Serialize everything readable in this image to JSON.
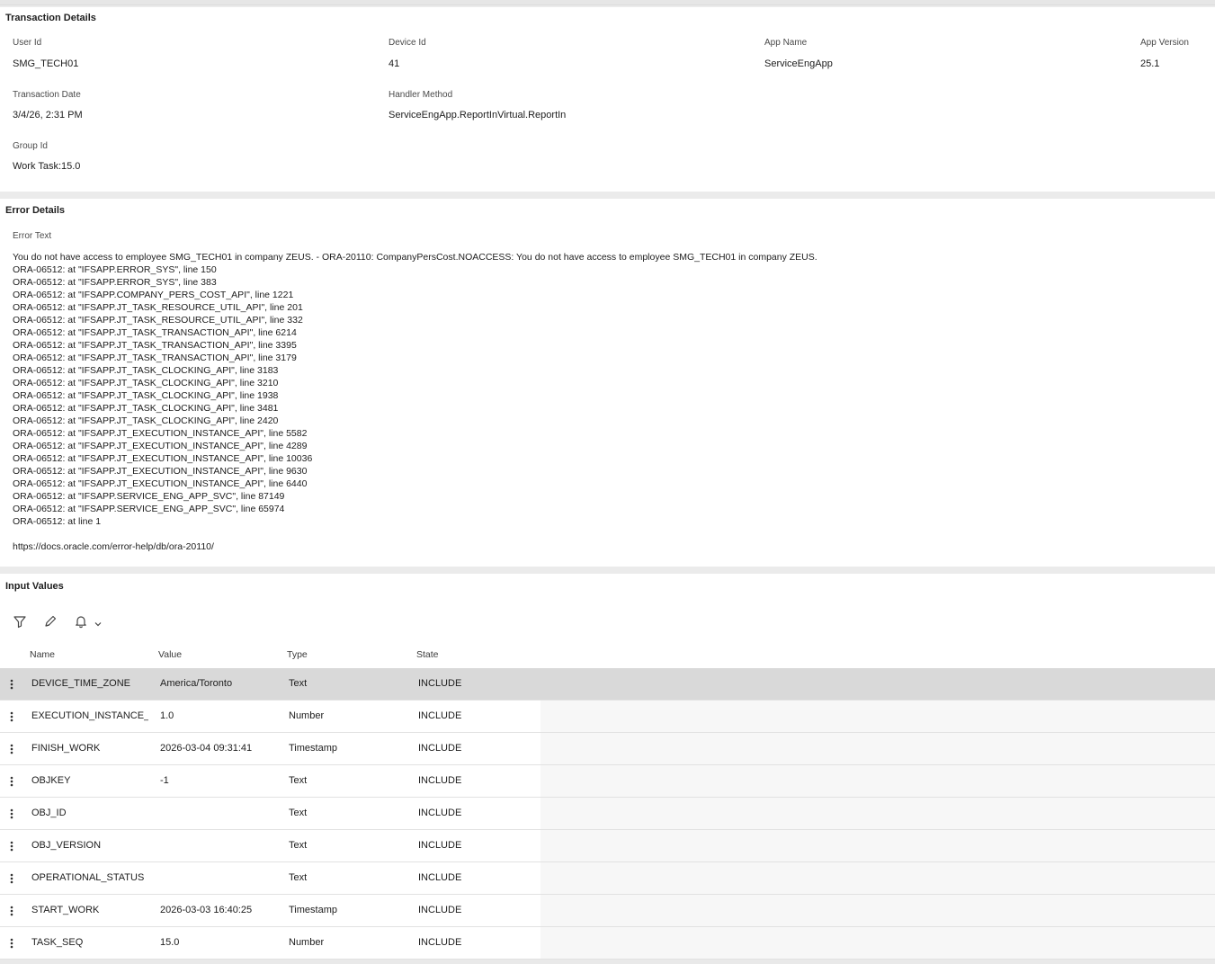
{
  "transaction": {
    "title": "Transaction Details",
    "user_id_label": "User Id",
    "user_id": "SMG_TECH01",
    "device_id_label": "Device Id",
    "device_id": "41",
    "app_name_label": "App Name",
    "app_name": "ServiceEngApp",
    "app_version_label": "App Version",
    "app_version": "25.1",
    "transaction_date_label": "Transaction Date",
    "transaction_date": "3/4/26, 2:31 PM",
    "handler_method_label": "Handler Method",
    "handler_method": "ServiceEngApp.ReportInVirtual.ReportIn",
    "group_id_label": "Group Id",
    "group_id": "Work Task:15.0"
  },
  "error": {
    "title": "Error Details",
    "text_label": "Error Text",
    "text": "You do not have access to employee SMG_TECH01 in company ZEUS. - ORA-20110: CompanyPersCost.NOACCESS: You do not have access to employee SMG_TECH01 in company ZEUS.\nORA-06512: at \"IFSAPP.ERROR_SYS\", line 150\nORA-06512: at \"IFSAPP.ERROR_SYS\", line 383\nORA-06512: at \"IFSAPP.COMPANY_PERS_COST_API\", line 1221\nORA-06512: at \"IFSAPP.JT_TASK_RESOURCE_UTIL_API\", line 201\nORA-06512: at \"IFSAPP.JT_TASK_RESOURCE_UTIL_API\", line 332\nORA-06512: at \"IFSAPP.JT_TASK_TRANSACTION_API\", line 6214\nORA-06512: at \"IFSAPP.JT_TASK_TRANSACTION_API\", line 3395\nORA-06512: at \"IFSAPP.JT_TASK_TRANSACTION_API\", line 3179\nORA-06512: at \"IFSAPP.JT_TASK_CLOCKING_API\", line 3183\nORA-06512: at \"IFSAPP.JT_TASK_CLOCKING_API\", line 3210\nORA-06512: at \"IFSAPP.JT_TASK_CLOCKING_API\", line 1938\nORA-06512: at \"IFSAPP.JT_TASK_CLOCKING_API\", line 3481\nORA-06512: at \"IFSAPP.JT_TASK_CLOCKING_API\", line 2420\nORA-06512: at \"IFSAPP.JT_EXECUTION_INSTANCE_API\", line 5582\nORA-06512: at \"IFSAPP.JT_EXECUTION_INSTANCE_API\", line 4289\nORA-06512: at \"IFSAPP.JT_EXECUTION_INSTANCE_API\", line 10036\nORA-06512: at \"IFSAPP.JT_EXECUTION_INSTANCE_API\", line 9630\nORA-06512: at \"IFSAPP.JT_EXECUTION_INSTANCE_API\", line 6440\nORA-06512: at \"IFSAPP.SERVICE_ENG_APP_SVC\", line 87149\nORA-06512: at \"IFSAPP.SERVICE_ENG_APP_SVC\", line 65974\nORA-06512: at line 1\n\nhttps://docs.oracle.com/error-help/db/ora-20110/"
  },
  "inputs": {
    "title": "Input Values",
    "toolbar_icons": [
      "filter-icon",
      "edit-icon",
      "bell-icon",
      "chevron-down-icon"
    ],
    "columns": [
      "Name",
      "Value",
      "Type",
      "State"
    ],
    "rows": [
      {
        "name": "DEVICE_TIME_ZONE",
        "value": "America/Toronto",
        "type": "Text",
        "state": "INCLUDE",
        "selected": true
      },
      {
        "name": "EXECUTION_INSTANCE_...",
        "value": "1.0",
        "type": "Number",
        "state": "INCLUDE"
      },
      {
        "name": "FINISH_WORK",
        "value": "2026-03-04 09:31:41",
        "type": "Timestamp",
        "state": "INCLUDE"
      },
      {
        "name": "OBJKEY",
        "value": "-1",
        "type": "Text",
        "state": "INCLUDE"
      },
      {
        "name": "OBJ_ID",
        "value": "",
        "type": "Text",
        "state": "INCLUDE"
      },
      {
        "name": "OBJ_VERSION",
        "value": "",
        "type": "Text",
        "state": "INCLUDE"
      },
      {
        "name": "OPERATIONAL_STATUS",
        "value": "",
        "type": "Text",
        "state": "INCLUDE"
      },
      {
        "name": "START_WORK",
        "value": "2026-03-03 16:40:25",
        "type": "Timestamp",
        "state": "INCLUDE"
      },
      {
        "name": "TASK_SEQ",
        "value": "15.0",
        "type": "Number",
        "state": "INCLUDE"
      }
    ]
  }
}
